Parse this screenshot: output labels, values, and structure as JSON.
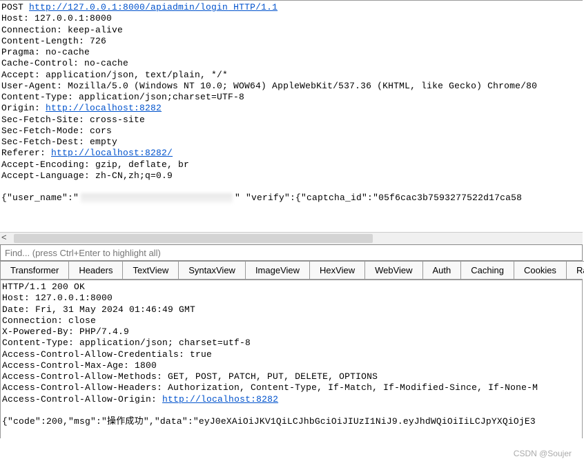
{
  "request": {
    "line1_method": "POST ",
    "line1_url": "http://127.0.0.1:8000/apiadmin/login",
    "line1_proto": " HTTP/1.1",
    "headers": [
      "Host: 127.0.0.1:8000",
      "Connection: keep-alive",
      "Content-Length: 726",
      "Pragma: no-cache",
      "Cache-Control: no-cache",
      "Accept: application/json, text/plain, */*",
      "User-Agent: Mozilla/5.0 (Windows NT 10.0; WOW64) AppleWebKit/537.36 (KHTML, like Gecko) Chrome/80",
      "Content-Type: application/json;charset=UTF-8"
    ],
    "origin_label": "Origin: ",
    "origin_url": "http://localhost:8282",
    "headers2": [
      "Sec-Fetch-Site: cross-site",
      "Sec-Fetch-Mode: cors",
      "Sec-Fetch-Dest: empty"
    ],
    "referer_label": "Referer: ",
    "referer_url": "http://localhost:8282/",
    "headers3": [
      "Accept-Encoding: gzip, deflate, br",
      "Accept-Language: zh-CN,zh;q=0.9"
    ],
    "body_pre": "{\"user_name\":\"",
    "body_mid": "\" \"verify\":{\"captcha_id\":\"05f6cac3b7593277522d17ca58"
  },
  "search": {
    "placeholder": "Find... (press Ctrl+Enter to highlight all)"
  },
  "tabs": [
    "Transformer",
    "Headers",
    "TextView",
    "SyntaxView",
    "ImageView",
    "HexView",
    "WebView",
    "Auth",
    "Caching",
    "Cookies",
    "Ra"
  ],
  "response": {
    "lines1": [
      "HTTP/1.1 200 OK",
      "Host: 127.0.0.1:8000",
      "Date: Fri, 31 May 2024 01:46:49 GMT",
      "Connection: close",
      "X-Powered-By: PHP/7.4.9",
      "Content-Type: application/json; charset=utf-8",
      "Access-Control-Allow-Credentials: true",
      "Access-Control-Max-Age: 1800",
      "Access-Control-Allow-Methods: GET, POST, PATCH, PUT, DELETE, OPTIONS",
      "Access-Control-Allow-Headers: Authorization, Content-Type, If-Match, If-Modified-Since, If-None-M"
    ],
    "acao_label": "Access-Control-Allow-Origin: ",
    "acao_url": "http://localhost:8282",
    "body": "{\"code\":200,\"msg\":\"操作成功\",\"data\":\"eyJ0eXAiOiJKV1QiLCJhbGciOiJIUzI1NiJ9.eyJhdWQiOiIiLCJpYXQiOjE3"
  },
  "watermark": "CSDN @Soujer"
}
